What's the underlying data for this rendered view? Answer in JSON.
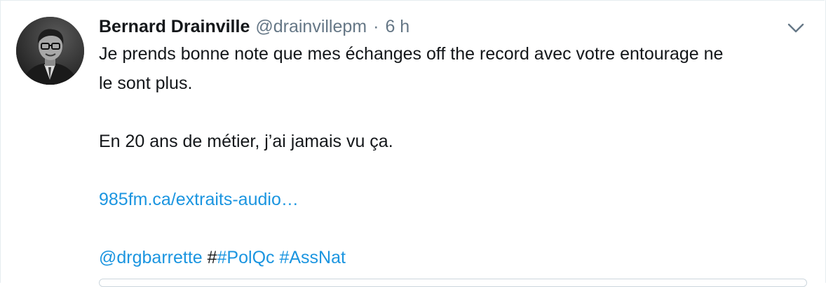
{
  "tweet": {
    "display_name": "Bernard Drainville",
    "handle": "@drainvillepm",
    "separator": "·",
    "time": "6 h",
    "avatar_icon": "profile-photo",
    "menu_icon": "chevron-down-icon",
    "body": {
      "line1": "Je prends bonne note que mes échanges off the record avec votre entourage ne",
      "line2": "le sont plus.",
      "line3": "En 20 ans de métier, j’ai jamais vu ça.",
      "link": "985fm.ca/extraits-audio…",
      "mention": "@drgbarrette",
      "hash_prefix": "#",
      "hashtag1": "#PolQc",
      "hashtag2": "#AssNat"
    }
  },
  "colors": {
    "link": "#1b95e0",
    "text": "#14171a",
    "secondary": "#657786",
    "border": "#e6ecf0"
  }
}
